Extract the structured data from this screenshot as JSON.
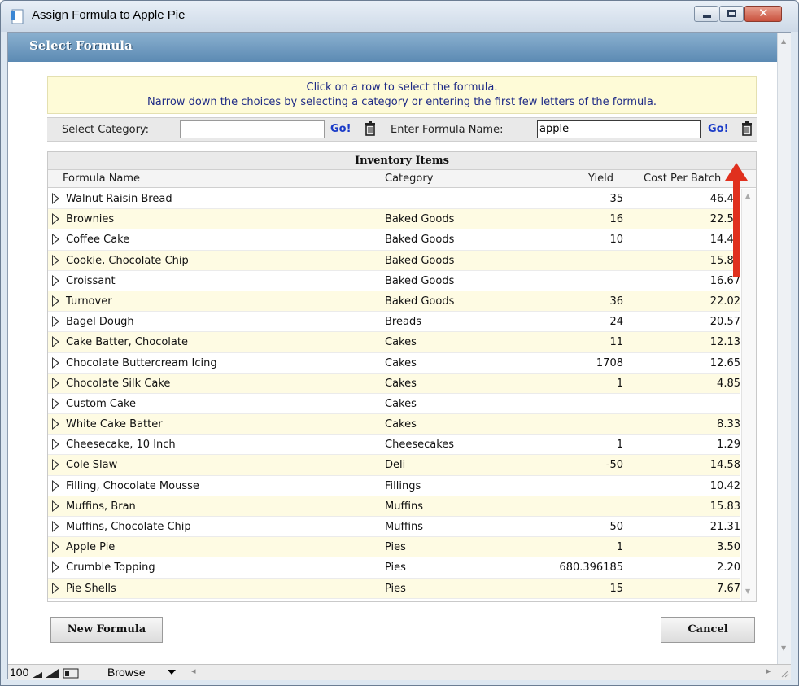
{
  "window": {
    "title": "Assign Formula to Apple Pie",
    "close_glyph": "✕"
  },
  "dialog": {
    "title": "Select Formula"
  },
  "instructions": {
    "line1": "Click on a row to select the formula.",
    "line2": "Narrow down the choices by selecting a category or entering the first few letters of the formula."
  },
  "filters": {
    "category_label": "Select Category:",
    "category_value": "",
    "go_label": "Go!",
    "name_label": "Enter Formula Name:",
    "name_value": "apple"
  },
  "table": {
    "group_title": "Inventory Items",
    "columns": {
      "name": "Formula Name",
      "category": "Category",
      "yield": "Yield",
      "cost": "Cost Per Batch"
    },
    "rows": [
      {
        "name": "Walnut Raisin Bread",
        "category": "",
        "yield": "35",
        "cost": "46.42"
      },
      {
        "name": "Brownies",
        "category": "Baked Goods",
        "yield": "16",
        "cost": "22.55"
      },
      {
        "name": "Coffee Cake",
        "category": "Baked Goods",
        "yield": "10",
        "cost": "14.44"
      },
      {
        "name": "Cookie, Chocolate Chip",
        "category": "Baked Goods",
        "yield": "",
        "cost": "15.80"
      },
      {
        "name": "Croissant",
        "category": "Baked Goods",
        "yield": "",
        "cost": "16.67"
      },
      {
        "name": "Turnover",
        "category": "Baked Goods",
        "yield": "36",
        "cost": "22.02"
      },
      {
        "name": "Bagel Dough",
        "category": "Breads",
        "yield": "24",
        "cost": "20.57"
      },
      {
        "name": "Cake Batter, Chocolate",
        "category": "Cakes",
        "yield": "11",
        "cost": "12.13"
      },
      {
        "name": "Chocolate Buttercream Icing",
        "category": "Cakes",
        "yield": "1708",
        "cost": "12.65"
      },
      {
        "name": "Chocolate Silk Cake",
        "category": "Cakes",
        "yield": "1",
        "cost": "4.85"
      },
      {
        "name": "Custom Cake",
        "category": "Cakes",
        "yield": "",
        "cost": ""
      },
      {
        "name": "White Cake Batter",
        "category": "Cakes",
        "yield": "",
        "cost": "8.33"
      },
      {
        "name": "Cheesecake, 10 Inch",
        "category": "Cheesecakes",
        "yield": "1",
        "cost": "1.29"
      },
      {
        "name": "Cole Slaw",
        "category": "Deli",
        "yield": "-50",
        "cost": "14.58"
      },
      {
        "name": "Filling, Chocolate Mousse",
        "category": "Fillings",
        "yield": "",
        "cost": "10.42"
      },
      {
        "name": "Muffins, Bran",
        "category": "Muffins",
        "yield": "",
        "cost": "15.83"
      },
      {
        "name": "Muffins, Chocolate Chip",
        "category": "Muffins",
        "yield": "50",
        "cost": "21.31"
      },
      {
        "name": "Apple Pie",
        "category": "Pies",
        "yield": "1",
        "cost": "3.50"
      },
      {
        "name": "Crumble Topping",
        "category": "Pies",
        "yield": "680.396185",
        "cost": "2.20"
      },
      {
        "name": "Pie Shells",
        "category": "Pies",
        "yield": "15",
        "cost": "7.67"
      }
    ]
  },
  "buttons": {
    "new_formula": "New Formula",
    "cancel": "Cancel"
  },
  "statusbar": {
    "zoom": "100",
    "mode": "Browse"
  },
  "colors": {
    "accent_arrow": "#e0301e",
    "go_link": "#1b3cc8",
    "row_alt": "#fefbe3",
    "header_blue": "#5c8ab3"
  },
  "icons": [
    "app-icon",
    "minimize-icon",
    "maximize-icon",
    "close-icon",
    "trash-icon",
    "expand-triangle-icon",
    "annotation-arrow-icon"
  ]
}
